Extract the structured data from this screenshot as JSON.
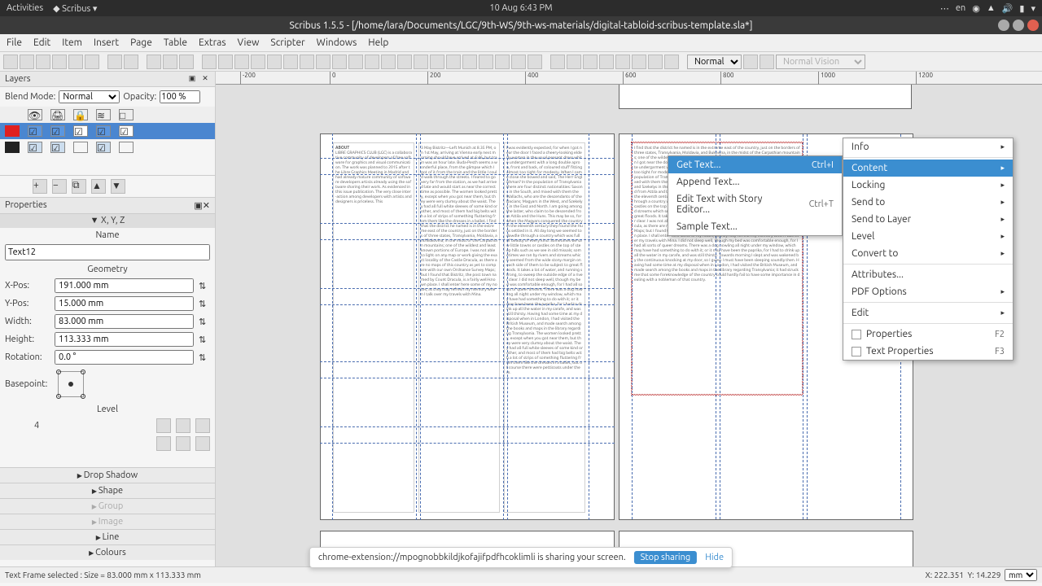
{
  "os": {
    "activities": "Activities",
    "app_menu": "Scribus",
    "clock": "10 Aug  6:43 PM",
    "lang": "en"
  },
  "window": {
    "title": "Scribus 1.5.5 - [/home/lara/Documents/LGC/9th-WS/9th-ws-materials/digital-tabloid-scribus-template.sla*]"
  },
  "menubar": [
    "File",
    "Edit",
    "Item",
    "Insert",
    "Page",
    "Table",
    "Extras",
    "View",
    "Scripter",
    "Windows",
    "Help"
  ],
  "toolbar": {
    "view_mode": "Normal",
    "vision_mode": "Normal Vision"
  },
  "layers": {
    "title": "Layers",
    "blend_label": "Blend Mode:",
    "blend_value": "Normal",
    "opacity_label": "Opacity:",
    "opacity_value": "100 %"
  },
  "properties": {
    "title": "Properties",
    "tab_xyz": "X, Y, Z",
    "name_label": "Name",
    "name_value": "Text12",
    "geometry_label": "Geometry",
    "xpos_label": "X-Pos:",
    "xpos_value": "191.000 mm",
    "ypos_label": "Y-Pos:",
    "ypos_value": "15.000 mm",
    "width_label": "Width:",
    "width_value": "83.000 mm",
    "height_label": "Height:",
    "height_value": "113.333 mm",
    "rotation_label": "Rotation:",
    "rotation_value": "0.0 °",
    "basepoint_label": "Basepoint:",
    "level_label": "Level",
    "level_value": "4",
    "sections": [
      "Drop Shadow",
      "Shape",
      "Group",
      "Image",
      "Line",
      "Colours"
    ]
  },
  "ruler_ticks": [
    "-200",
    "0",
    "200",
    "400",
    "600",
    "800",
    "1000",
    "1200"
  ],
  "frame_heading": "ABOUT",
  "ctx_submenu": {
    "get_text": "Get Text...",
    "get_text_sc": "Ctrl+I",
    "append": "Append Text...",
    "story": "Edit Text with Story Editor...",
    "story_sc": "Ctrl+T",
    "sample": "Sample Text..."
  },
  "ctx_main": {
    "info": "Info",
    "content": "Content",
    "locking": "Locking",
    "send_to": "Send to",
    "send_layer": "Send to Layer",
    "level": "Level",
    "convert": "Convert to",
    "attributes": "Attributes...",
    "pdf": "PDF Options",
    "edit": "Edit",
    "properties": "Properties",
    "properties_sc": "F2",
    "tprops": "Text Properties",
    "tprops_sc": "F3"
  },
  "status": {
    "selection": "Text Frame selected : Size = 83.000 mm x 113.333 mm",
    "x_label": "X:",
    "x_val": "222.351",
    "y_label": "Y:",
    "y_val": "14.229",
    "unit": "mm"
  },
  "sharebar": {
    "msg": "chrome-extension://mpognobbkildjkofajifpdfhcoklimli is sharing your screen.",
    "stop": "Stop sharing",
    "hide": "Hide"
  }
}
